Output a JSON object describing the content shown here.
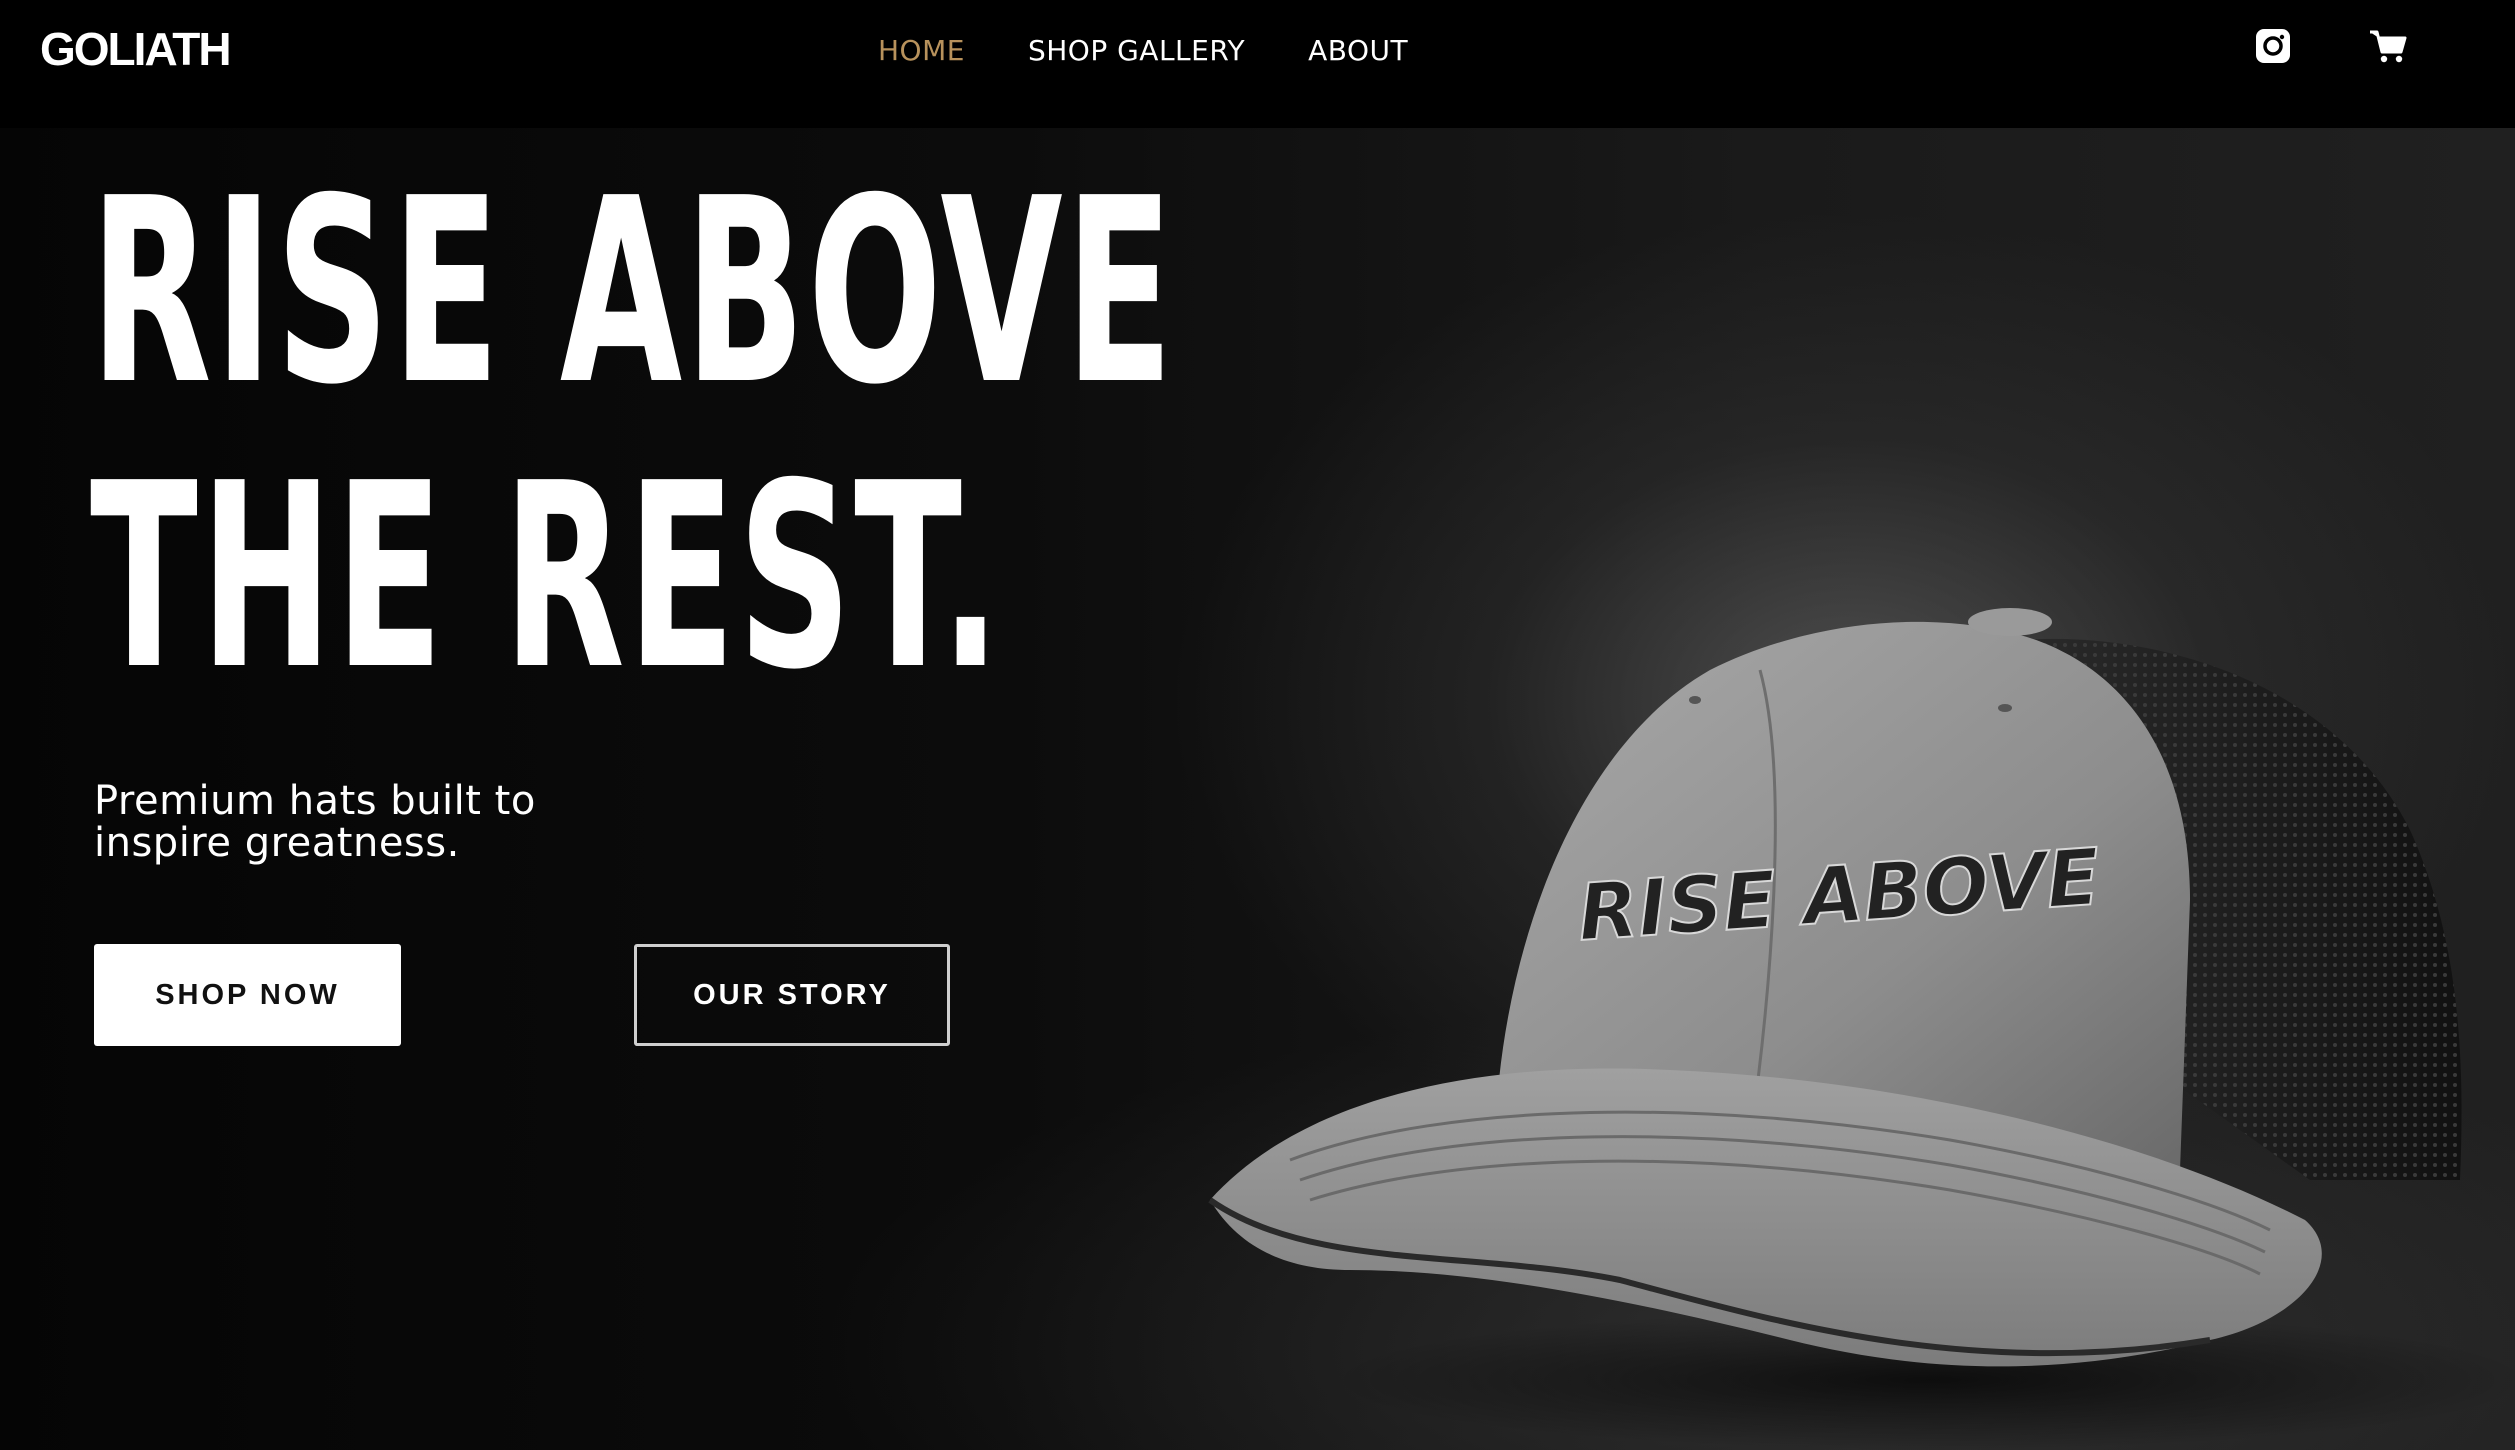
{
  "brand": {
    "logo": "GOLIATH"
  },
  "nav": {
    "items": [
      {
        "label": "HOME",
        "active": true
      },
      {
        "label": "SHOP GALLERY",
        "active": false
      },
      {
        "label": "ABOUT",
        "active": false
      }
    ]
  },
  "header_icons": {
    "instagram": "instagram-icon",
    "cart": "cart-icon"
  },
  "hero": {
    "headline_line1": "RISE ABOVE",
    "headline_line2": "THE REST.",
    "subtitle": "Premium hats built to inspire greatness.",
    "primary_button": "SHOP NOW",
    "secondary_button": "OUR STORY",
    "cap_embroidery": "RISE ABOVE"
  },
  "colors": {
    "accent": "#b8925c",
    "header_bg": "#000000",
    "text": "#ffffff"
  }
}
